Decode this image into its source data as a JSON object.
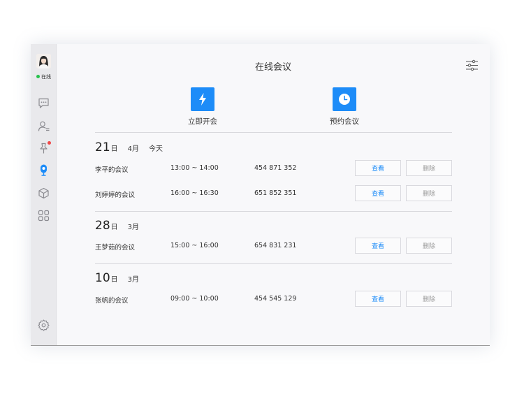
{
  "sidebar": {
    "status_text": "在线",
    "icons": [
      "chat-icon",
      "contacts-icon",
      "pin-icon",
      "meeting-icon",
      "box-icon",
      "apps-icon",
      "gear-icon"
    ],
    "accent": "#1d8cf8",
    "badge_color": "#f04848",
    "online_color": "#27c24c"
  },
  "header": {
    "title": "在线会议"
  },
  "actions": [
    {
      "label": "立即开会",
      "icon": "lightning-icon"
    },
    {
      "label": "预约会议",
      "icon": "clock-icon"
    }
  ],
  "groups": [
    {
      "day": "21",
      "day_suffix": "日",
      "month": "4月",
      "tag": "今天",
      "meetings": [
        {
          "name": "李平的会议",
          "time": "13:00 ~ 14:00",
          "id": "454 871 352",
          "view": "查看",
          "delete": "删除"
        },
        {
          "name": "刘婷婷的会议",
          "time": "16:00 ~ 16:30",
          "id": "651 852 351",
          "view": "查看",
          "delete": "删除"
        }
      ]
    },
    {
      "day": "28",
      "day_suffix": "日",
      "month": "3月",
      "tag": "",
      "meetings": [
        {
          "name": "王梦茹的会议",
          "time": "15:00 ~ 16:00",
          "id": "654 831 231",
          "view": "查看",
          "delete": "删除"
        }
      ]
    },
    {
      "day": "10",
      "day_suffix": "日",
      "month": "3月",
      "tag": "",
      "meetings": [
        {
          "name": "张帆的会议",
          "time": "09:00 ~ 10:00",
          "id": "454 545 129",
          "view": "查看",
          "delete": "删除"
        }
      ]
    }
  ]
}
